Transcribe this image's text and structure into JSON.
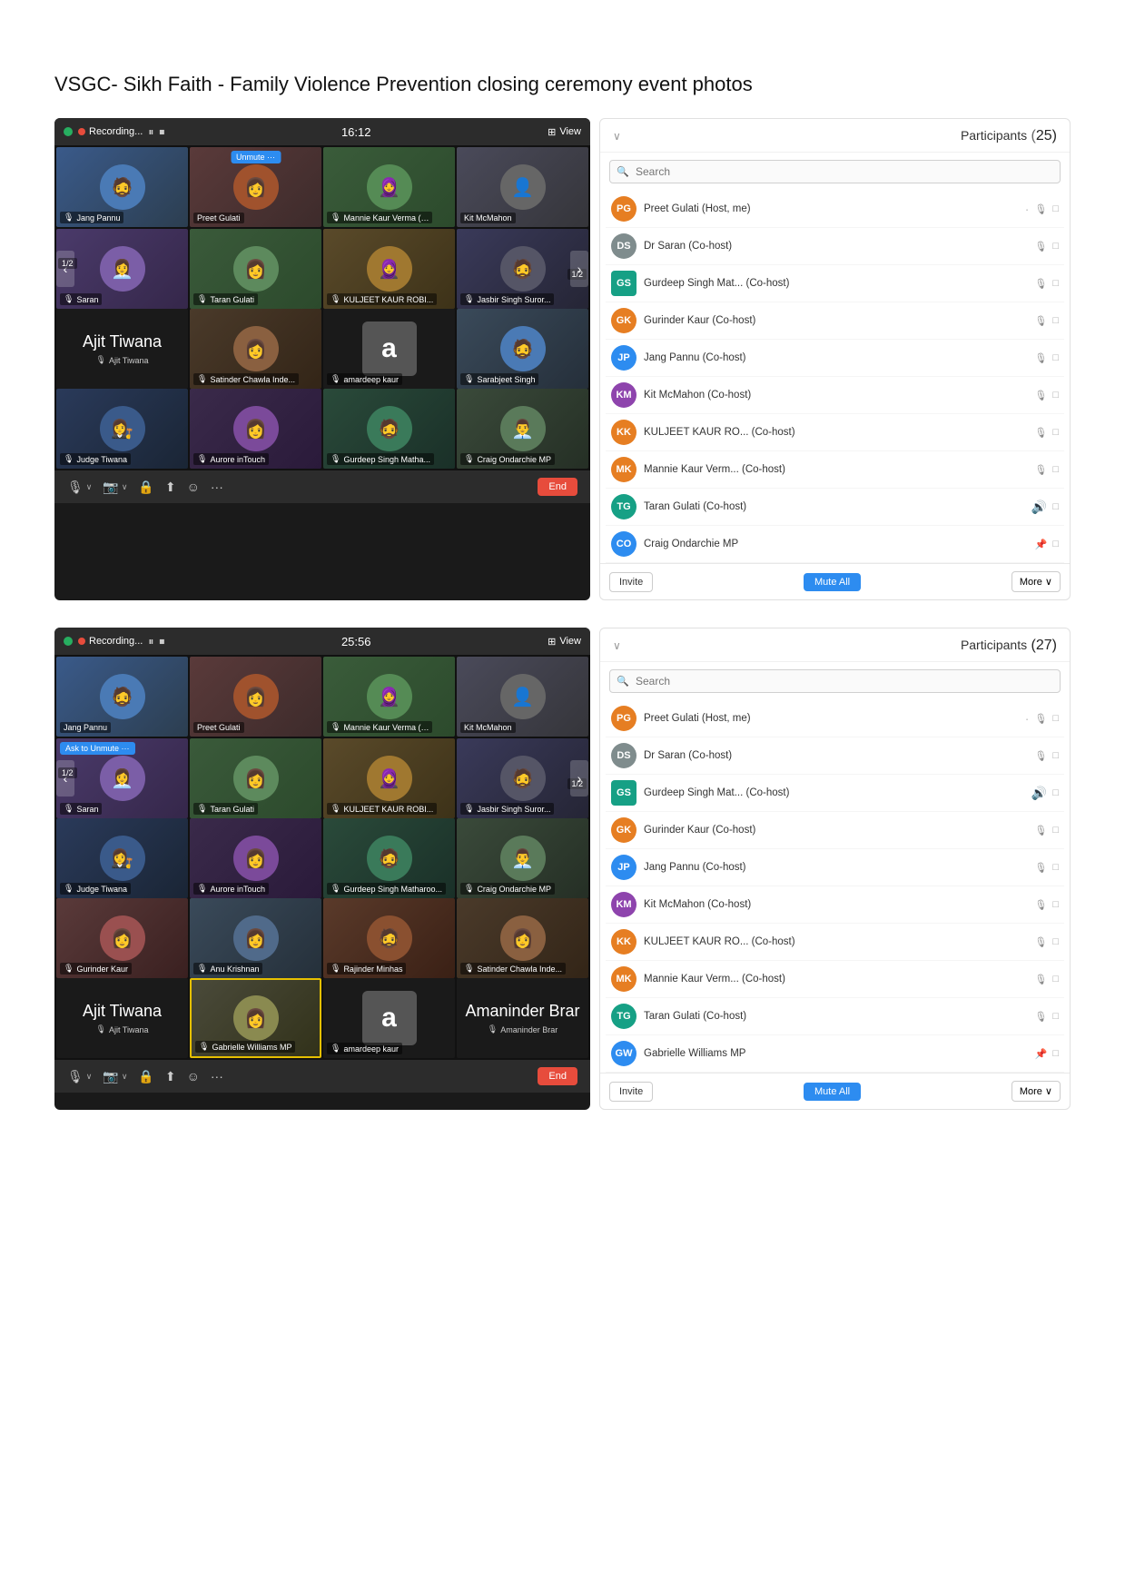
{
  "page": {
    "title": "VSGC- Sikh Faith - Family Violence Prevention closing ceremony event photos"
  },
  "screenshot1": {
    "topbar": {
      "recording_label": "Recording...",
      "time": "16:12",
      "view_label": "View"
    },
    "participants_panel": {
      "title": "Participants",
      "count": "25",
      "search_placeholder": "Search",
      "participants": [
        {
          "name": "Preet Gulati (Host, me)",
          "role": "",
          "muted": true,
          "video_off": true,
          "avatar_color": "c-orange",
          "initials": "PG",
          "has_dot": true
        },
        {
          "name": "Dr Saran (Co-host)",
          "role": "",
          "muted": true,
          "video_off": true,
          "avatar_color": "c-gray",
          "initials": "DS"
        },
        {
          "name": "Gurdeep Singh Mat... (Co-host)",
          "role": "",
          "muted": true,
          "video_off": true,
          "avatar_color": "c-teal",
          "initials": "GS"
        },
        {
          "name": "Gurinder Kaur (Co-host)",
          "role": "",
          "muted": true,
          "video_off": true,
          "avatar_color": "c-orange",
          "initials": "GK"
        },
        {
          "name": "Jang Pannu (Co-host)",
          "role": "",
          "muted": true,
          "video_off": true,
          "avatar_color": "c-blue",
          "initials": "JP"
        },
        {
          "name": "Kit McMahon (Co-host)",
          "role": "",
          "muted": true,
          "video_off": true,
          "avatar_color": "c-purple",
          "initials": "KM"
        },
        {
          "name": "KULJEET KAUR RO... (Co-host)",
          "role": "",
          "muted": true,
          "video_off": true,
          "avatar_color": "c-orange",
          "initials": "KK"
        },
        {
          "name": "Mannie Kaur Verm... (Co-host)",
          "role": "",
          "muted": true,
          "video_off": true,
          "avatar_color": "c-orange",
          "initials": "MK"
        },
        {
          "name": "Taran Gulati (Co-host)",
          "role": "",
          "muted": false,
          "video_off": true,
          "avatar_color": "c-teal",
          "initials": "TG"
        },
        {
          "name": "Craig Ondarchie MP",
          "role": "",
          "muted": false,
          "video_off": true,
          "avatar_color": "c-blue",
          "initials": "CO"
        }
      ],
      "footer": {
        "invite_label": "Invite",
        "mute_all_label": "Mute All",
        "more_label": "More ∨"
      }
    },
    "video_cells": [
      {
        "id": "jang-pannu",
        "name": "Jang Pannu",
        "type": "photo",
        "col": 1
      },
      {
        "id": "preet-gulati",
        "name": "Preet Gulati",
        "type": "photo",
        "unmute_btn": true,
        "col": 2
      },
      {
        "id": "mannie-kaur",
        "name": "Mannie Kaur Verma (…",
        "type": "photo",
        "col": 3
      },
      {
        "id": "kit-mcmahon",
        "name": "Kit McMahon",
        "type": "photo",
        "col": 4
      },
      {
        "id": "saran",
        "name": "Saran",
        "type": "photo",
        "col": 1
      },
      {
        "id": "taran-gulati",
        "name": "Taran Gulati",
        "type": "photo",
        "col": 2
      },
      {
        "id": "kuljeet",
        "name": "KULJEET KAUR ROBI...",
        "type": "photo",
        "col": 3
      },
      {
        "id": "jasbir-singh",
        "name": "Jasbir Singh Suror...",
        "type": "photo",
        "col": 4
      },
      {
        "id": "ajit-tiwana-big",
        "name": "Ajit Tiwana",
        "type": "big-name",
        "span_col": 1
      },
      {
        "id": "judge-tiwana",
        "name": "Judge Tiwana",
        "type": "photo",
        "col": 1
      },
      {
        "id": "aurore-intouch",
        "name": "Aurore inTouch",
        "type": "photo",
        "col": 2
      },
      {
        "id": "gurdeep-singh",
        "name": "Gurdeep Singh Matha...",
        "type": "photo",
        "col": 3
      },
      {
        "id": "craig-ondarchie",
        "name": "Craig Ondarchie MP",
        "type": "photo",
        "col": 4
      },
      {
        "id": "gurinder-kaur",
        "name": "Gurinder Kaur",
        "type": "photo",
        "col": 1
      },
      {
        "id": "anu-krishnan",
        "name": "Anu Krishnan",
        "type": "photo",
        "col": 2
      },
      {
        "id": "amaninder-brar",
        "name": "Amaninder Brar",
        "type": "photo",
        "col": 3
      },
      {
        "id": "rajinder-minhas",
        "name": "Rajinder Minhas",
        "type": "photo",
        "col": 4
      },
      {
        "id": "satinder-chawla",
        "name": "Satinder Chawla Inde...",
        "type": "photo",
        "col": 2
      },
      {
        "id": "amardeep-kaur",
        "name": "amardeep kaur",
        "type": "letter",
        "letter": "a",
        "col": 3
      },
      {
        "id": "sarabjeet-singh",
        "name": "Sarabjeet Singh",
        "type": "photo",
        "col": 4
      }
    ],
    "bottom_controls": [
      "mic",
      "video",
      "security",
      "share",
      "reactions",
      "more",
      "end"
    ]
  },
  "screenshot2": {
    "topbar": {
      "recording_label": "Recording...",
      "time": "25:56",
      "view_label": "View"
    },
    "participants_panel": {
      "title": "Participants",
      "count": "27",
      "search_placeholder": "Search",
      "participants": [
        {
          "name": "Preet Gulati (Host, me)",
          "role": "",
          "muted": true,
          "video_off": true,
          "avatar_color": "c-orange",
          "initials": "PG",
          "has_dot": true
        },
        {
          "name": "Dr Saran (Co-host)",
          "role": "",
          "muted": true,
          "video_off": true,
          "avatar_color": "c-gray",
          "initials": "DS"
        },
        {
          "name": "Gurdeep Singh Mat... (Co-host)",
          "role": "",
          "muted": false,
          "video_off": true,
          "avatar_color": "c-teal",
          "initials": "GS"
        },
        {
          "name": "Gurinder Kaur (Co-host)",
          "role": "",
          "muted": true,
          "video_off": true,
          "avatar_color": "c-orange",
          "initials": "GK"
        },
        {
          "name": "Jang Pannu (Co-host)",
          "role": "",
          "muted": true,
          "video_off": true,
          "avatar_color": "c-blue",
          "initials": "JP"
        },
        {
          "name": "Kit McMahon (Co-host)",
          "role": "",
          "muted": true,
          "video_off": true,
          "avatar_color": "c-purple",
          "initials": "KM"
        },
        {
          "name": "KULJEET KAUR RO... (Co-host)",
          "role": "",
          "muted": true,
          "video_off": true,
          "avatar_color": "c-orange",
          "initials": "KK"
        },
        {
          "name": "Mannie Kaur Verm... (Co-host)",
          "role": "",
          "muted": true,
          "video_off": true,
          "avatar_color": "c-orange",
          "initials": "MK"
        },
        {
          "name": "Taran Gulati (Co-host)",
          "role": "",
          "muted": true,
          "video_off": true,
          "avatar_color": "c-teal",
          "initials": "TG"
        },
        {
          "name": "Gabrielle Williams MP",
          "role": "",
          "muted": false,
          "video_off": true,
          "avatar_color": "c-blue",
          "initials": "GW"
        }
      ],
      "footer": {
        "invite_label": "Invite",
        "mute_all_label": "Mute All",
        "more_label": "More ∨"
      }
    }
  },
  "icons": {
    "search": "🔍",
    "mic_off": "🎙",
    "video_off": "📷",
    "chevron_down": "∨",
    "left_arrow": "‹",
    "right_arrow": "›"
  }
}
